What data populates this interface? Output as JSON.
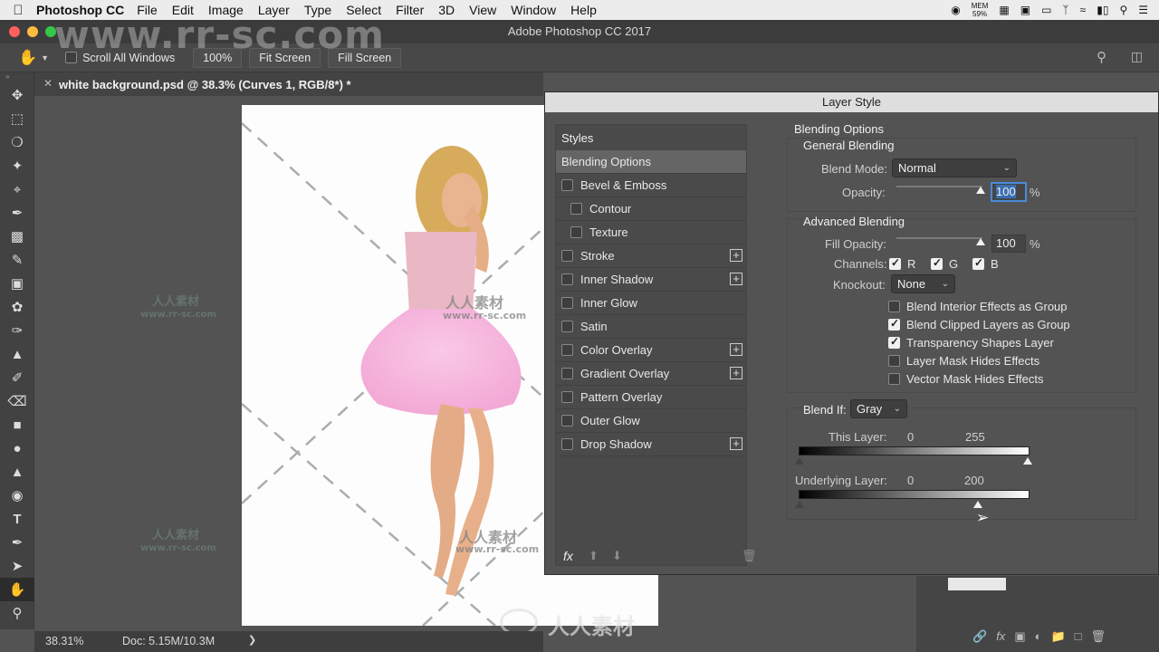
{
  "menubar": {
    "app_name": "Photoshop CC",
    "items": [
      "File",
      "Edit",
      "Image",
      "Layer",
      "Type",
      "Select",
      "Filter",
      "3D",
      "View",
      "Window",
      "Help"
    ],
    "mem_label": "MEM",
    "mem_value": "59%"
  },
  "window": {
    "title": "Adobe Photoshop CC 2017"
  },
  "options": {
    "scroll_all_windows": "Scroll All Windows",
    "zoom_button": "100%",
    "fit_screen": "Fit Screen",
    "fill_screen": "Fill Screen"
  },
  "document": {
    "tab_title": "white background.psd @ 38.3% (Curves 1, RGB/8*) *",
    "zoom": "38.31%",
    "doc_size": "Doc: 5.15M/10.3M"
  },
  "watermarks": {
    "site": "www.rr-sc.com",
    "cn": "人人素材"
  },
  "dialog": {
    "title": "Layer Style",
    "styles_header": "Styles",
    "style_items": [
      {
        "label": "Blending Options",
        "checkbox": false,
        "plus": false,
        "selected": true,
        "indent": false
      },
      {
        "label": "Bevel & Emboss",
        "checkbox": true,
        "plus": false,
        "selected": false,
        "indent": false
      },
      {
        "label": "Contour",
        "checkbox": true,
        "plus": false,
        "selected": false,
        "indent": true
      },
      {
        "label": "Texture",
        "checkbox": true,
        "plus": false,
        "selected": false,
        "indent": true
      },
      {
        "label": "Stroke",
        "checkbox": true,
        "plus": true,
        "selected": false,
        "indent": false
      },
      {
        "label": "Inner Shadow",
        "checkbox": true,
        "plus": true,
        "selected": false,
        "indent": false
      },
      {
        "label": "Inner Glow",
        "checkbox": true,
        "plus": false,
        "selected": false,
        "indent": false
      },
      {
        "label": "Satin",
        "checkbox": true,
        "plus": false,
        "selected": false,
        "indent": false
      },
      {
        "label": "Color Overlay",
        "checkbox": true,
        "plus": true,
        "selected": false,
        "indent": false
      },
      {
        "label": "Gradient Overlay",
        "checkbox": true,
        "plus": true,
        "selected": false,
        "indent": false
      },
      {
        "label": "Pattern Overlay",
        "checkbox": true,
        "plus": false,
        "selected": false,
        "indent": false
      },
      {
        "label": "Outer Glow",
        "checkbox": true,
        "plus": false,
        "selected": false,
        "indent": false
      },
      {
        "label": "Drop Shadow",
        "checkbox": true,
        "plus": true,
        "selected": false,
        "indent": false
      }
    ],
    "blending_options_header": "Blending Options",
    "general_blending": {
      "header": "General Blending",
      "blend_mode_label": "Blend Mode:",
      "blend_mode_value": "Normal",
      "opacity_label": "Opacity:",
      "opacity_value": "100",
      "unit": "%"
    },
    "advanced_blending": {
      "header": "Advanced Blending",
      "fill_opacity_label": "Fill Opacity:",
      "fill_opacity_value": "100",
      "unit": "%",
      "channels_label": "Channels:",
      "channel_r": "R",
      "channel_g": "G",
      "channel_b": "B",
      "knockout_label": "Knockout:",
      "knockout_value": "None",
      "checkboxes": [
        {
          "label": "Blend Interior Effects as Group",
          "checked": false
        },
        {
          "label": "Blend Clipped Layers as Group",
          "checked": true
        },
        {
          "label": "Transparency Shapes Layer",
          "checked": true
        },
        {
          "label": "Layer Mask Hides Effects",
          "checked": false
        },
        {
          "label": "Vector Mask Hides Effects",
          "checked": false
        }
      ]
    },
    "blend_if": {
      "label": "Blend If:",
      "value": "Gray",
      "this_layer_label": "This Layer:",
      "this_layer_low": "0",
      "this_layer_high": "255",
      "underlying_label": "Underlying Layer:",
      "underlying_low": "0",
      "underlying_high": "200"
    },
    "footer": {
      "fx_label": "fx"
    }
  },
  "colors": {
    "panel_bg": "#535353",
    "dark_bg": "#424242",
    "selected_row": "#656565",
    "focus_blue": "#4a8bd8"
  }
}
